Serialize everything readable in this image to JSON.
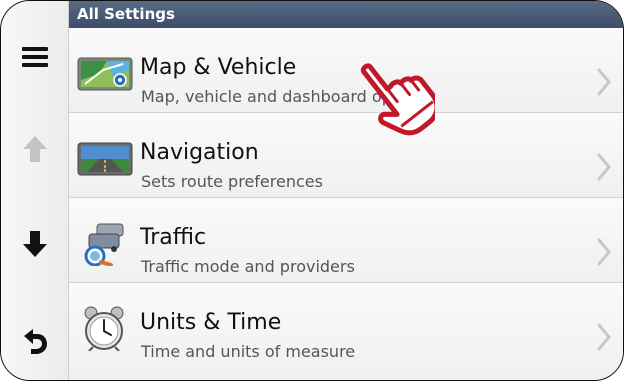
{
  "header": {
    "title": "All Settings"
  },
  "sidebar": {
    "items": [
      {
        "icon": "menu-icon"
      },
      {
        "icon": "arrow-up-icon"
      },
      {
        "icon": "arrow-down-icon"
      },
      {
        "icon": "back-icon"
      }
    ]
  },
  "settings": [
    {
      "title": "Map & Vehicle",
      "subtitle": "Map, vehicle and dashboard options",
      "icon": "map-icon"
    },
    {
      "title": "Navigation",
      "subtitle": "Sets route preferences",
      "icon": "road-icon"
    },
    {
      "title": "Traffic",
      "subtitle": "Traffic mode and providers",
      "icon": "traffic-icon"
    },
    {
      "title": "Units & Time",
      "subtitle": "Time and units of measure",
      "icon": "alarm-clock-icon"
    }
  ],
  "colors": {
    "header_bg": "#4a5a76",
    "hand_red": "#c0182a"
  }
}
